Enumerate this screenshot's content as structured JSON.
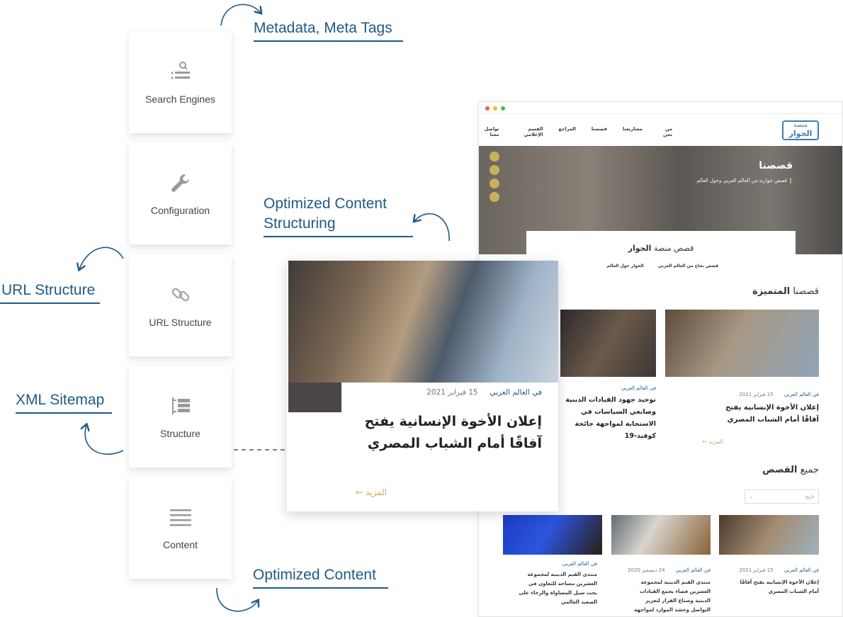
{
  "cards": [
    {
      "label": "Search Engines",
      "icon": "search-list-icon"
    },
    {
      "label": "Configuration",
      "icon": "wrench-icon"
    },
    {
      "label": "URL Structure",
      "icon": "link-icon"
    },
    {
      "label": "Structure",
      "icon": "structure-icon"
    },
    {
      "label": "Content",
      "icon": "lines-icon"
    }
  ],
  "tags": {
    "metadata": "Metadata, Meta Tags",
    "structuring_1": "Optimized Content",
    "structuring_2": "Structuring",
    "url": "URL Structure",
    "sitemap": "XML Sitemap",
    "content": "Optimized Content"
  },
  "colors": {
    "accent": "#1f5a86",
    "gold": "#c9a96e"
  },
  "site": {
    "logo_1": "منصة",
    "logo_2": "الحوار",
    "nav": [
      "من نحن",
      "مشاريعنا",
      "قصصنا",
      "المراجع",
      "القسم الإعلامي",
      "تواصل معنا"
    ],
    "hero_title": "قصصنا",
    "hero_sub": "قصص حوارية من العالم العربي وحول العالم",
    "section_title_a": "قصص منصة ",
    "section_title_b": "الحوار",
    "tabs": [
      "قصص نجاح من العالم العربي",
      "الحوار حول العالم"
    ],
    "featured_a": "قصصنا ",
    "featured_b": "المتميزة",
    "featured": [
      {
        "cat": "في العالم العربي",
        "date": "15 فبراير 2021",
        "title": "إعلان الأخوة الإنسانية يفتح آفاقًا أمام الشباب المصري",
        "more": "المزيد"
      },
      {
        "cat": "في العالم العربي",
        "date": "",
        "title": "توحيد جهود القيادات الدينية وصانعي السياسات في الاستجابة لمواجهة جائحة كوفيد-19"
      }
    ],
    "all_a": "جميع ",
    "all_b": "القصص",
    "select_value": "تاريخ",
    "grid": [
      {
        "cat": "في العالم العربي",
        "date": "15 فبراير 2021",
        "title": "إعلان الأخوة الإنسانية يفتح آفاقًا أمام الشباب المصري"
      },
      {
        "cat": "في العالم العربي",
        "date": "24 ديسمبر 2020",
        "title": "منتدى القيم الدينية لمجموعة العشرين فضاء يجمع القيادات الدينية وصناع القرار لتعزيز التواصل وحشد الموارد لمواجهة التحديات العالمية"
      },
      {
        "cat": "في العالم العربي",
        "date": "",
        "title": "منتدى القيم الدينية لمجموعة العشرين مساحة للتعاون في بحث سبل المساواة والرخاء على الصعيد العالمي"
      }
    ]
  },
  "overlay": {
    "cat": "في العالم العربي",
    "date": "15 فبراير 2021",
    "title": "إعلان الأخوة الإنسانية يفتح آفاقًا أمام الشباب المصري",
    "more": "المزيد"
  }
}
